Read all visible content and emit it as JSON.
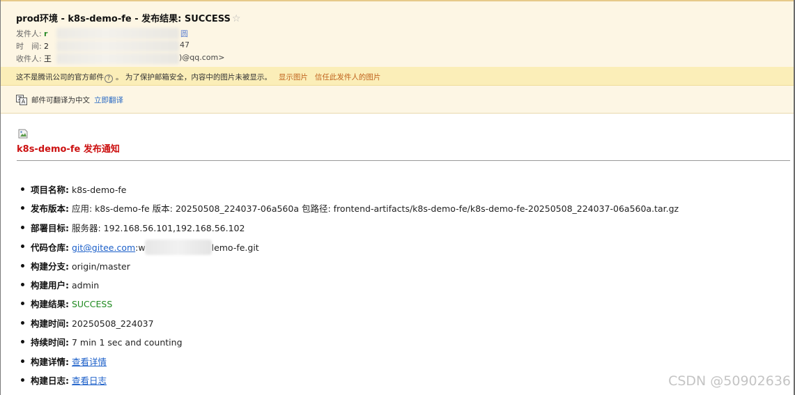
{
  "header": {
    "subject": "prod环境 - k8s-demo-fe - 发布结果: SUCCESS",
    "star_icon": "star-icon",
    "from_label": "发件人:",
    "from_value_visible": "r",
    "from_tail": "圆",
    "time_label": "时　间:",
    "time_value_visible": "2",
    "time_tail": "47",
    "to_label": "收件人:",
    "to_value_visible": "王",
    "to_tail": ")@qq.com>"
  },
  "warning_bar": {
    "text_before": "这不是腾讯公司的官方邮件",
    "help_glyph": "?",
    "text_after": "。 为了保护邮箱安全，内容中的图片未被显示。",
    "show_images_link": "显示图片",
    "trust_sender_link": "信任此发件人的图片"
  },
  "translate_bar": {
    "icon": "translate-icon",
    "text": "邮件可翻译为中文",
    "translate_link": "立即翻译"
  },
  "notification": {
    "title": "k8s-demo-fe 发布通知",
    "items": [
      {
        "key": "项目名称:",
        "value": " k8s-demo-fe"
      },
      {
        "key": "发布版本:",
        "value": " 应用: k8s-demo-fe 版本: 20250508_224037-06a560a 包路径: frontend-artifacts/k8s-demo-fe/k8s-demo-fe-20250508_224037-06a560a.tar.gz"
      },
      {
        "key": "部署目标:",
        "value": " 服务器: 192.168.56.101,192.168.56.102"
      },
      {
        "key": "代码仓库:",
        "link": "git@gitee.com",
        "value_after_link": ":w",
        "value_tail": "lemo-fe.git"
      },
      {
        "key": "构建分支:",
        "value": " origin/master"
      },
      {
        "key": "构建用户:",
        "value": " admin"
      },
      {
        "key": "构建结果:",
        "value": " SUCCESS"
      },
      {
        "key": "构建时间:",
        "value": " 20250508_224037"
      },
      {
        "key": "持续时间:",
        "value": " 7 min 1 sec and counting"
      },
      {
        "key": "构建详情:",
        "link": "查看详情"
      },
      {
        "key": "构建日志:",
        "link": "查看日志"
      }
    ]
  },
  "colors": {
    "header_bg": "#fdf6e4",
    "warning_bg": "#fbeeb8",
    "title_red": "#cc1111",
    "success_green": "#1f8a1f",
    "link_blue": "#1b5fc9"
  },
  "watermark": "CSDN @50902636"
}
